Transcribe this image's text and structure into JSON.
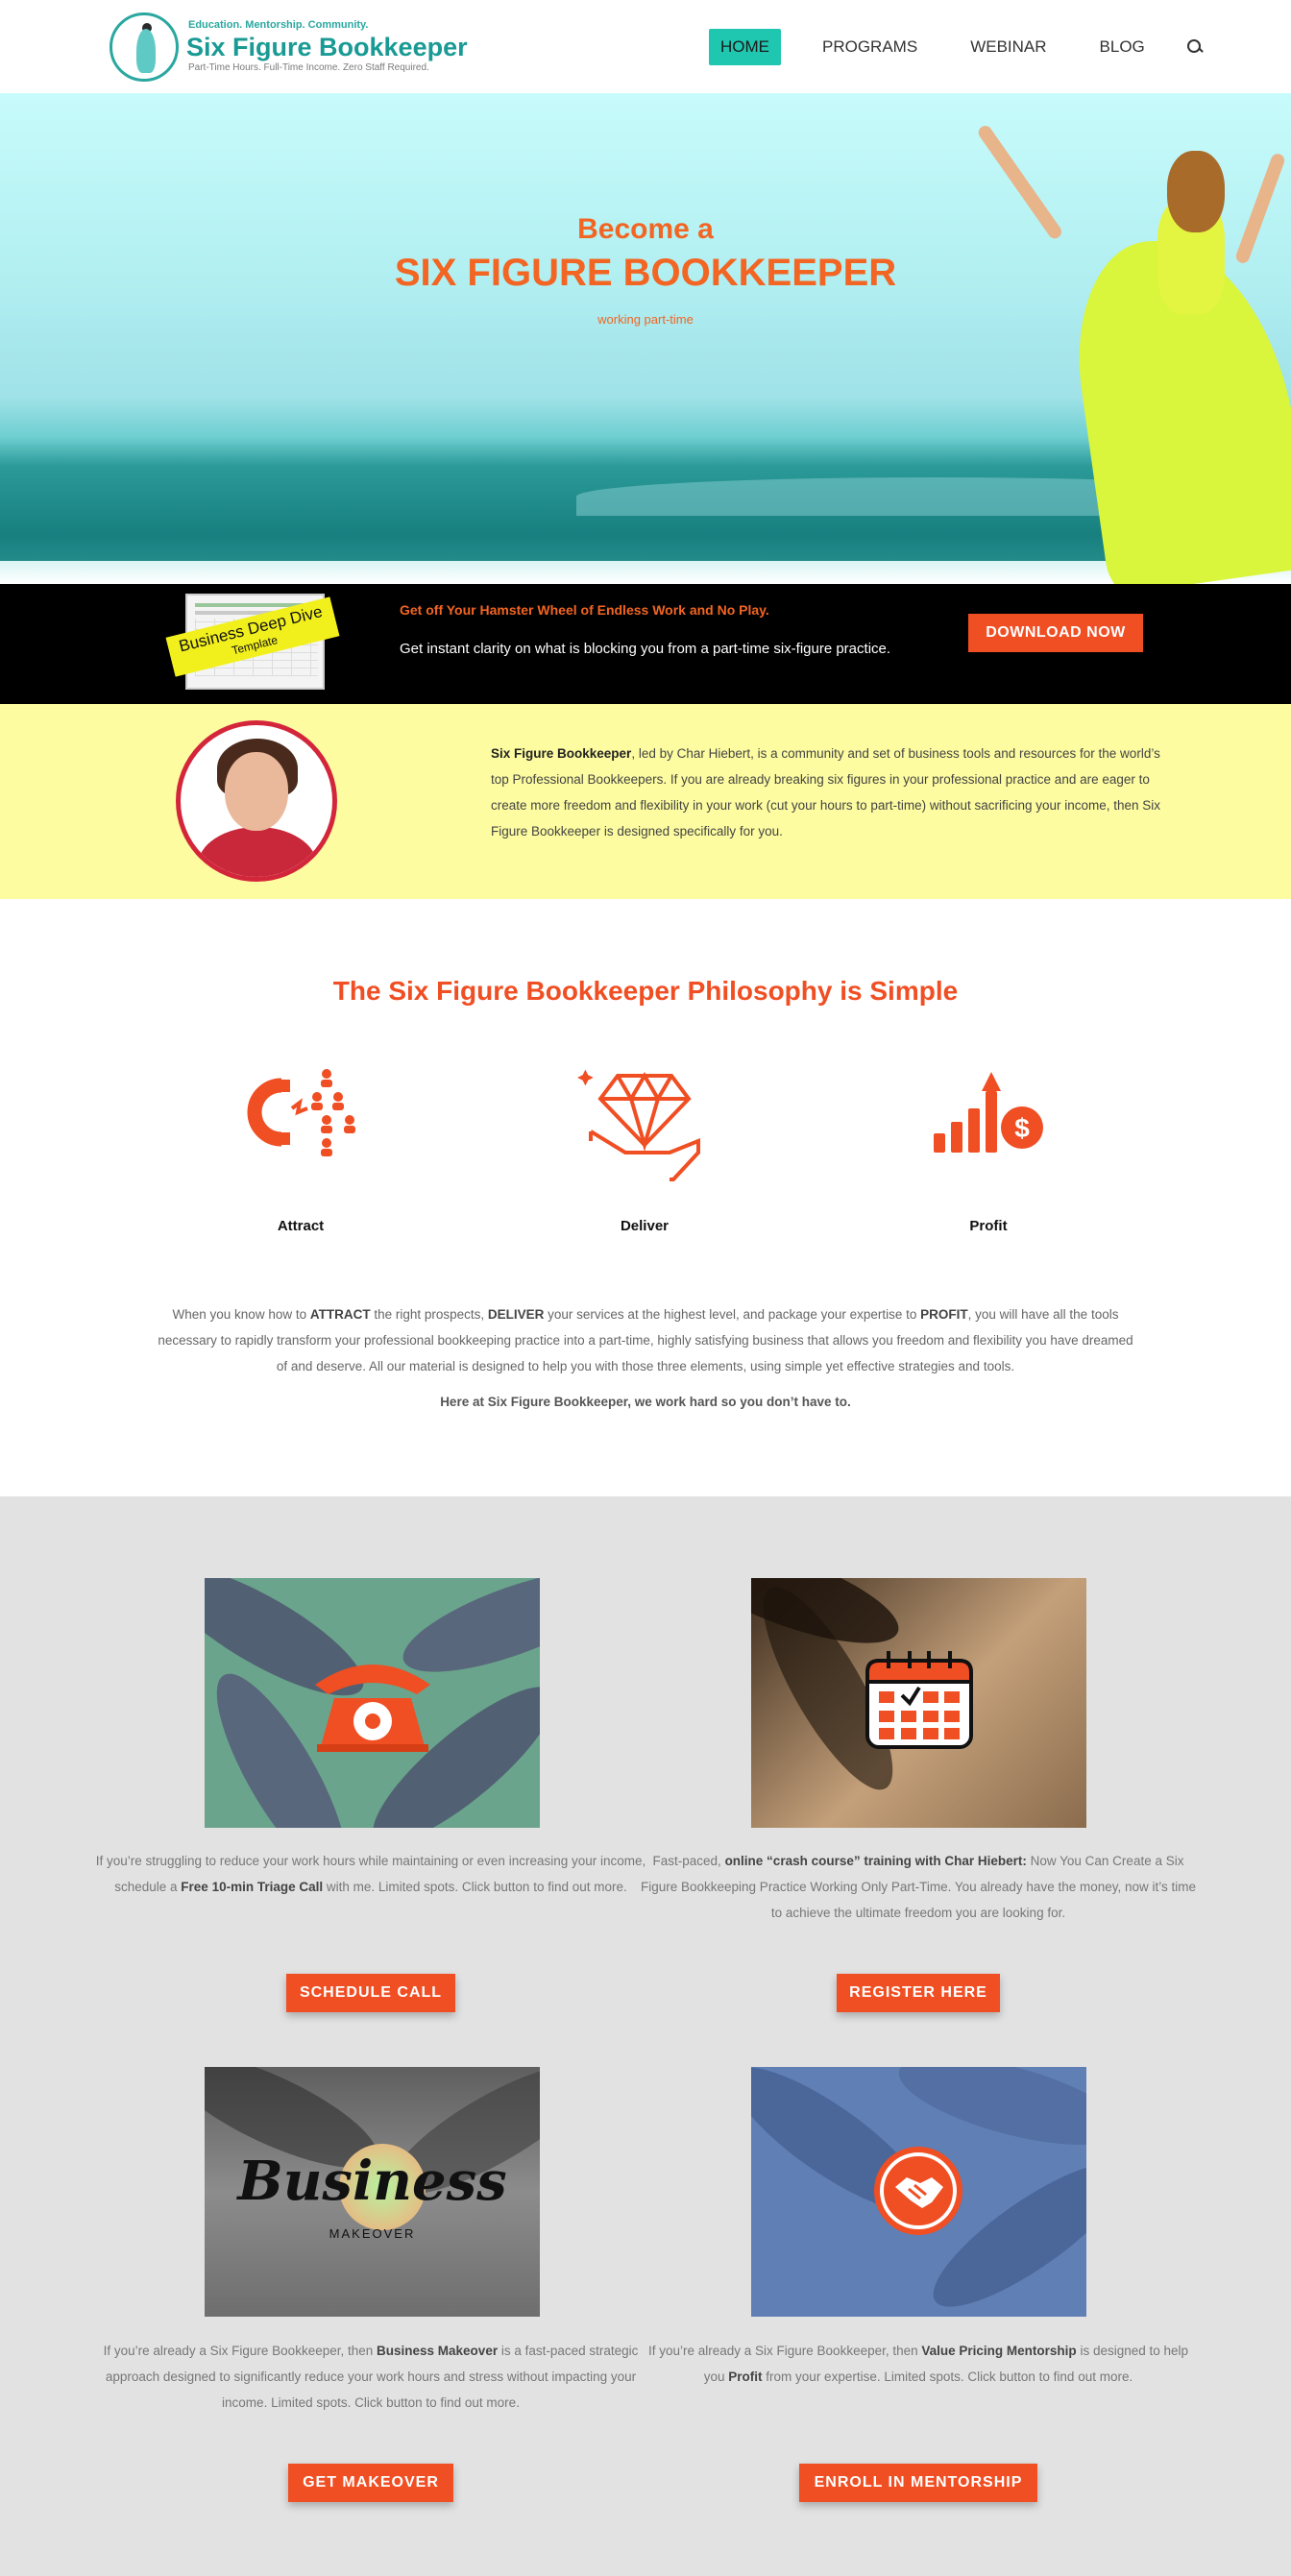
{
  "header": {
    "logo": {
      "tagline": "Education. Mentorship. Community.",
      "name": "Six Figure Bookkeeper",
      "subline": "Part-Time Hours. Full-Time Income. Zero Staff Required."
    },
    "nav": [
      {
        "label": "HOME",
        "active": true
      },
      {
        "label": "PROGRAMS",
        "active": false
      },
      {
        "label": "WEBINAR",
        "active": false
      },
      {
        "label": "BLOG",
        "active": false
      }
    ],
    "search_icon": "search-icon"
  },
  "hero": {
    "pre_title": "Become a",
    "title": "SIX FIGURE BOOKKEEPER",
    "subtitle": "working part-time"
  },
  "cta_bar": {
    "thumbnail_label_1": "Business Deep Dive",
    "thumbnail_label_2": "Template",
    "headline": "Get off Your Hamster Wheel of Endless Work and No Play.",
    "text": "Get instant clarity on what is blocking you from a part-time six-figure practice.",
    "button": "DOWNLOAD NOW"
  },
  "intro": {
    "brand": "Six Figure Bookkeeper",
    "text": ", led by Char Hiebert, is a community and set of business tools and resources for the world’s top Professional Bookkeepers. If you are already breaking six figures in your professional practice and are eager to create more freedom and flexibility in your work (cut your hours to part-time) without sacrificing your income, then Six Figure Bookkeeper is designed specifically for you."
  },
  "philosophy": {
    "title": "The Six Figure Bookkeeper Philosophy is Simple",
    "pillars": [
      {
        "label": "Attract",
        "icon": "magnet-people-icon"
      },
      {
        "label": "Deliver",
        "icon": "diamond-hand-icon"
      },
      {
        "label": "Profit",
        "icon": "growth-dollar-icon"
      }
    ],
    "text_1": "When you know how to ",
    "attract": "ATTRACT",
    "text_2": " the right prospects, ",
    "deliver": "DELIVER",
    "text_3": " your services at the highest level, and package your expertise to ",
    "profit": "PROFIT",
    "text_4": ", you will have all the tools necessary to rapidly transform your professional bookkeeping practice into a part-time, highly satisfying business that allows you freedom and flexibility you have dreamed of and deserve. All our material is designed to help you with those three elements, using simple yet effective strategies and tools.",
    "closing": "Here at Six Figure Bookkeeper, we work hard so you don’t have to."
  },
  "offers": [
    {
      "image_icon": "telephone-icon",
      "text_a": "If you’re struggling to reduce your work hours while maintaining or even increasing your income, schedule a ",
      "bold": "Free 10-min Triage Call",
      "text_b": " with me. Limited spots. Click button to find out more.",
      "button": "SCHEDULE CALL"
    },
    {
      "image_icon": "calendar-check-icon",
      "text_a": "Fast-paced, ",
      "bold": "online “crash course” training with Char Hiebert:",
      "text_b": " Now You Can Create a Six Figure Bookkeeping Practice Working Only Part-Time. You already have the money, now it’s time to achieve the ultimate freedom you are looking for.",
      "button": "REGISTER HERE"
    },
    {
      "image_title": "Business",
      "image_subtitle": "MAKEOVER",
      "text_a": "If you’re already a Six Figure Bookkeeper, then ",
      "bold": "Business Makeover",
      "text_b": " is a fast-paced strategic approach designed to significantly reduce your work hours and stress without impacting your income.  Limited spots. Click button to find out more.",
      "button": "GET MAKEOVER"
    },
    {
      "image_icon": "handshake-icon",
      "text_a": "If you’re already a Six Figure Bookkeeper, then ",
      "bold": "Value Pricing Mentorship",
      "text_b": " is designed to help you ",
      "bold_2": "Profit",
      "text_c": " from your expertise. Limited spots. Click button to find out more.",
      "button": "ENROLL IN MENTORSHIP"
    }
  ],
  "colors": {
    "accent": "#f04e23",
    "teal": "#1fc7b0",
    "intro_bg": "#fdfca0",
    "offers_bg": "#e2e2e2"
  }
}
